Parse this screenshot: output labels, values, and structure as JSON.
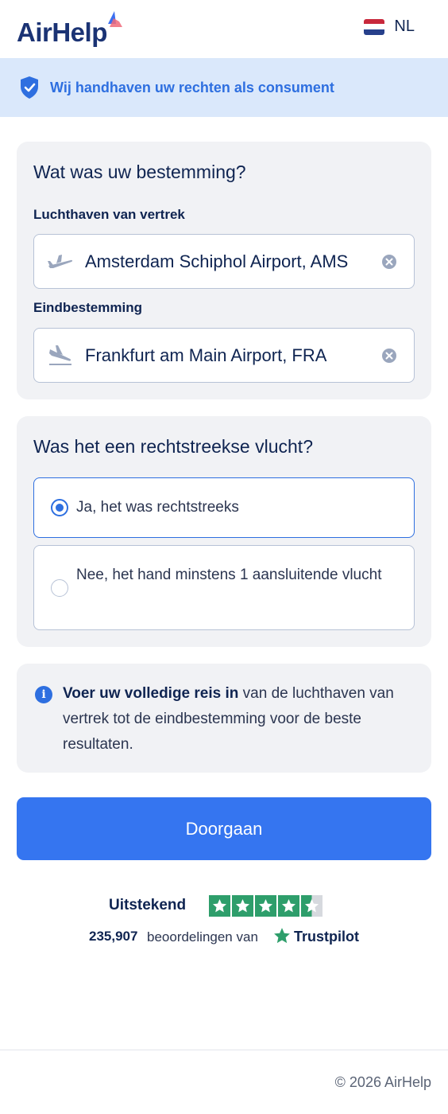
{
  "header": {
    "logo_text": "AirHelp",
    "language_code": "NL"
  },
  "banner": {
    "text": "Wij handhaven uw rechten als consument"
  },
  "destination": {
    "title": "Wat was uw bestemming?",
    "departure_label": "Luchthaven van vertrek",
    "departure_value": "Amsterdam Schiphol Airport, AMS",
    "arrival_label": "Eindbestemming",
    "arrival_value": "Frankfurt am Main Airport, FRA"
  },
  "direct_flight": {
    "title": "Was het een rechtstreekse vlucht?",
    "options": [
      {
        "label": "Ja, het was rechtstreeks",
        "selected": true
      },
      {
        "label": "Nee, het hand minstens 1 aansluitende vlucht",
        "selected": false
      }
    ]
  },
  "info": {
    "bold": "Voer uw volledige reis in",
    "rest": " van de luchthaven van vertrek tot de eindbestemming voor de beste resultaten."
  },
  "cta": {
    "label": "Doorgaan"
  },
  "trustpilot": {
    "rating_label": "Uitstekend",
    "stars": 4.5,
    "review_count": "235,907",
    "reviews_text": "beoordelingen van",
    "brand": "Trustpilot"
  },
  "footer": {
    "copyright": "© 2026 AirHelp"
  },
  "colors": {
    "accent": "#3575f0",
    "banner_bg": "#dae8fb",
    "trustpilot_green": "#2e9e6b"
  }
}
